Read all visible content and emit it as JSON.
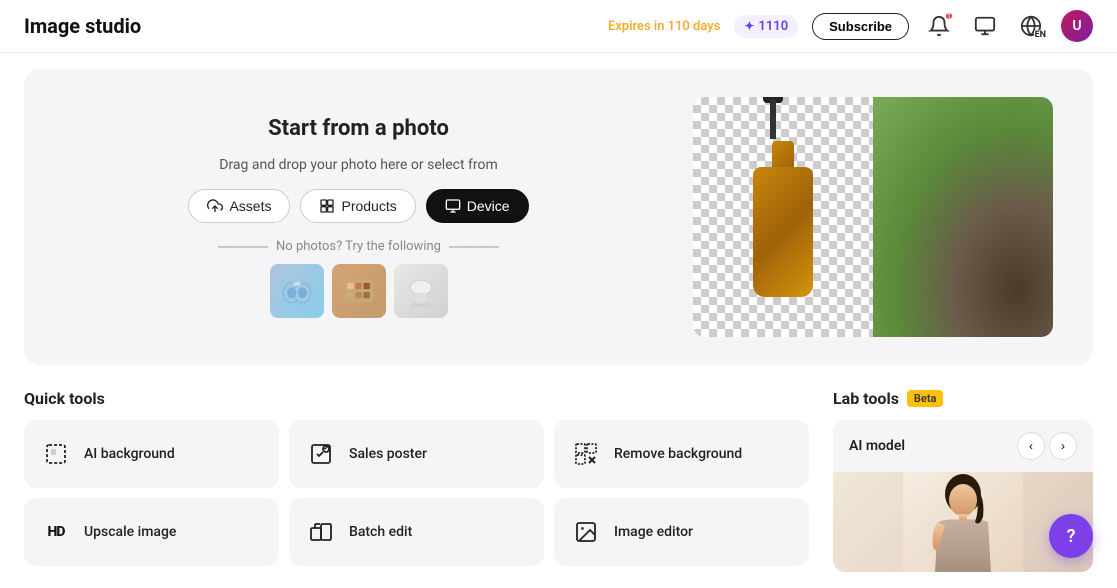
{
  "header": {
    "logo": "Image studio",
    "expires_text": "Expires in 110 days",
    "credits": "1110",
    "subscribe_label": "Subscribe",
    "notif_count": "1"
  },
  "upload_card": {
    "title": "Start from a photo",
    "subtitle": "Drag and drop your photo here or select from",
    "btn_assets": "Assets",
    "btn_products": "Products",
    "btn_device": "Device",
    "no_photos_label": "No photos? Try the following"
  },
  "quick_tools": {
    "section_title": "Quick tools",
    "tools": [
      {
        "id": "ai-background",
        "label": "AI background",
        "icon": "dashed-square"
      },
      {
        "id": "sales-poster",
        "label": "Sales poster",
        "icon": "poster"
      },
      {
        "id": "remove-background",
        "label": "Remove background",
        "icon": "remove-bg"
      },
      {
        "id": "upscale-image",
        "label": "Upscale image",
        "icon": "hd"
      },
      {
        "id": "batch-edit",
        "label": "Batch edit",
        "icon": "batch"
      },
      {
        "id": "image-editor",
        "label": "Image editor",
        "icon": "image-editor"
      }
    ]
  },
  "lab_tools": {
    "section_title": "Lab tools",
    "beta_label": "Beta",
    "ai_model_label": "AI model"
  },
  "help_btn": "?"
}
